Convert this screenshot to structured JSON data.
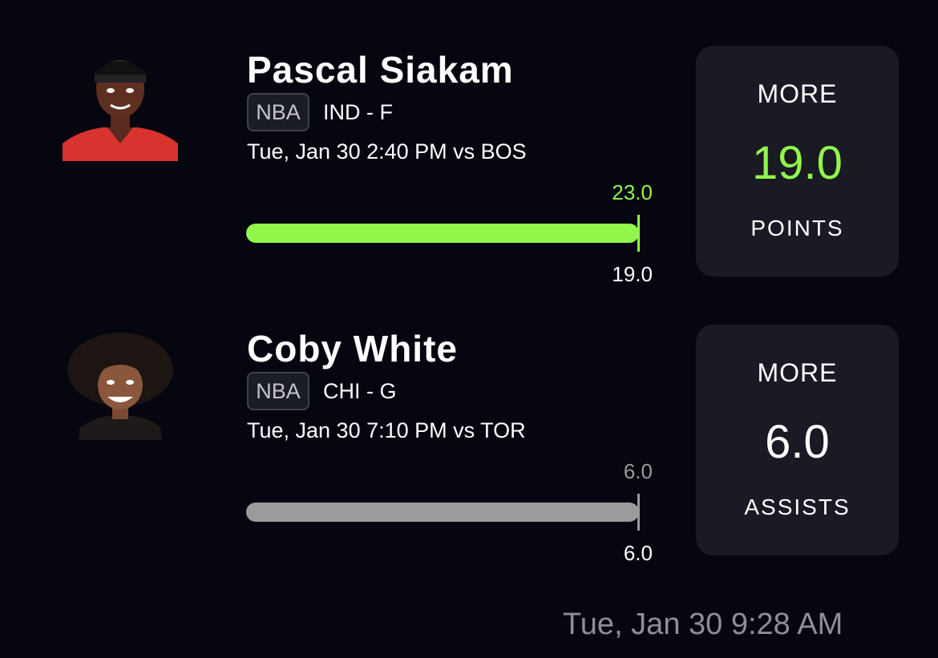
{
  "colors": {
    "background": "#05060f",
    "card": "#191a23",
    "over_green": "#91f74b",
    "push_gray": "#9b9b9b",
    "badge_border": "#3f4149"
  },
  "picks": [
    {
      "player": "Pascal Siakam",
      "league": "NBA",
      "team_pos": "IND - F",
      "game": "Tue, Jan 30 2:40 PM  vs BOS",
      "actual": "23.0",
      "line": "19.0",
      "progress_fraction": 1.0,
      "status": "won",
      "direction": "MORE",
      "card_value": "19.0",
      "stat": "POINTS",
      "avatar": "player-headshot-siakam"
    },
    {
      "player": "Coby White",
      "league": "NBA",
      "team_pos": "CHI - G",
      "game": "Tue, Jan 30 7:10 PM  vs TOR",
      "actual": "6.0",
      "line": "6.0",
      "progress_fraction": 1.0,
      "status": "push",
      "direction": "MORE",
      "card_value": "6.0",
      "stat": "ASSISTS",
      "avatar": "player-headshot-white"
    }
  ],
  "timestamp": "Tue, Jan 30 9:28 AM"
}
